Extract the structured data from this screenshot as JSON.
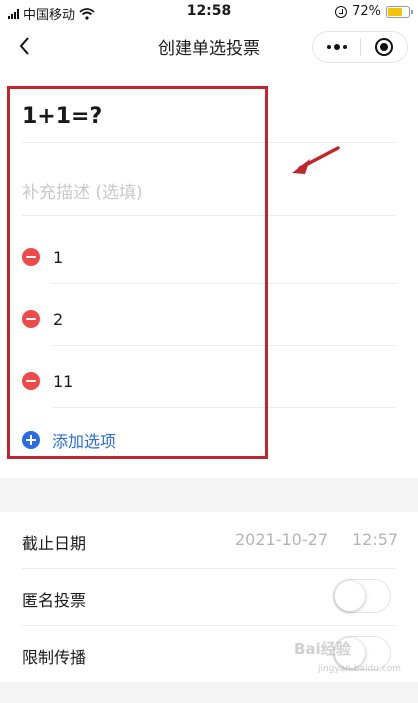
{
  "status_bar": {
    "carrier": "中国移动",
    "time": "12:58",
    "battery": "72%",
    "battery_level": 0.72
  },
  "nav": {
    "title": "创建单选投票",
    "icons": [
      "back-icon",
      "more-icon",
      "close-icon"
    ]
  },
  "poll": {
    "question": "1+1=?",
    "description_placeholder": "补充描述 (选填)",
    "options": [
      "1",
      "2",
      "11"
    ],
    "add_option_label": "添加选项"
  },
  "settings": {
    "deadline_label": "截止日期",
    "deadline_date": "2021-10-27",
    "deadline_time": "12:57",
    "anonymous_label": "匿名投票",
    "anonymous_enabled": false,
    "restrict_label": "限制传播",
    "restrict_enabled": false
  },
  "watermark": {
    "text": "Bai经验",
    "sub": "jingyan.baidu.com"
  },
  "colors": {
    "annotation": "#c0272d",
    "accent": "#2a6be6",
    "delete": "#ef4a4a"
  }
}
